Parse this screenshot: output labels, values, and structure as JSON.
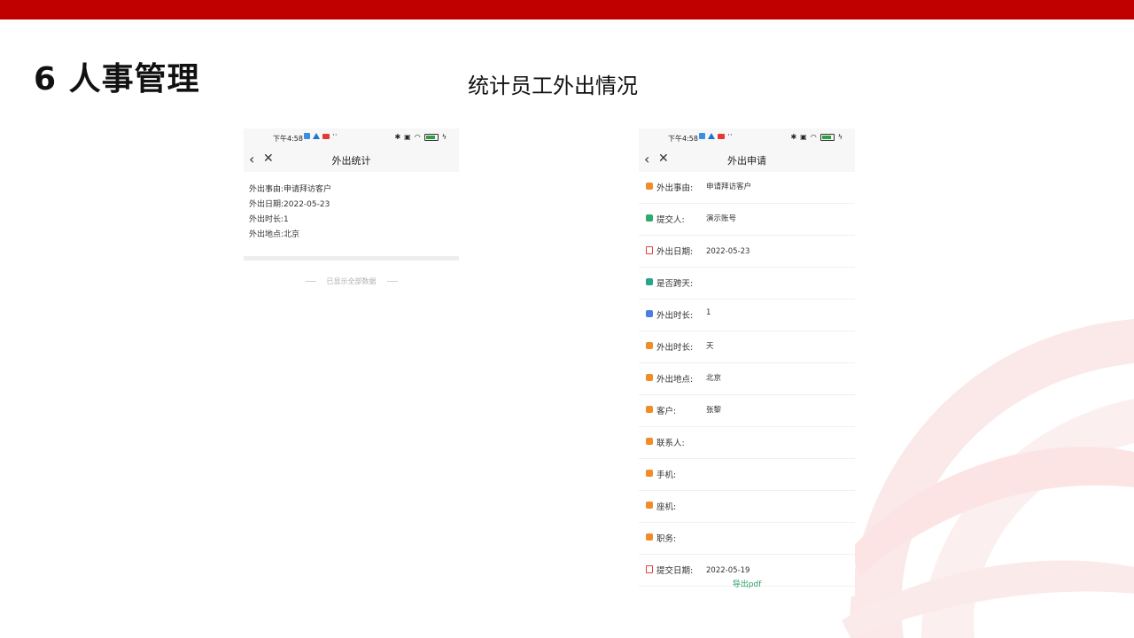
{
  "slide": {
    "title": "6 人事管理",
    "subtitle": "统计员工外出情况"
  },
  "status_bar": {
    "time": "下午4:58",
    "battery": "100"
  },
  "left_phone": {
    "nav_title": "外出统计",
    "lines": [
      "外出事由:申请拜访客户",
      "外出日期:2022-05-23",
      "外出时长:1",
      "外出地点:北京"
    ],
    "end_note": "已显示全部数据"
  },
  "right_phone": {
    "nav_title": "外出申请",
    "fields": [
      {
        "label": "外出事由:",
        "value": "申请拜访客户"
      },
      {
        "label": "提交人:",
        "value": "演示账号"
      },
      {
        "label": "外出日期:",
        "value": "2022-05-23"
      },
      {
        "label": "是否跨天:",
        "value": ""
      },
      {
        "label": "外出时长:",
        "value": "1"
      },
      {
        "label": "外出时长:",
        "value": "天"
      },
      {
        "label": "外出地点:",
        "value": "北京"
      },
      {
        "label": "客户:",
        "value": "张黎"
      },
      {
        "label": "联系人:",
        "value": ""
      },
      {
        "label": "手机:",
        "value": ""
      },
      {
        "label": "座机:",
        "value": ""
      },
      {
        "label": "职务:",
        "value": ""
      },
      {
        "label": "提交日期:",
        "value": "2022-05-19"
      }
    ],
    "export_label": "导出pdf"
  },
  "icons": {
    "back": "chevron-left-icon",
    "close": "close-icon",
    "bluetooth": "bluetooth-icon",
    "wifi": "wifi-icon",
    "battery": "battery-icon"
  },
  "colors": {
    "brand_red": "#c00000",
    "export_green": "#2a9d6a"
  }
}
